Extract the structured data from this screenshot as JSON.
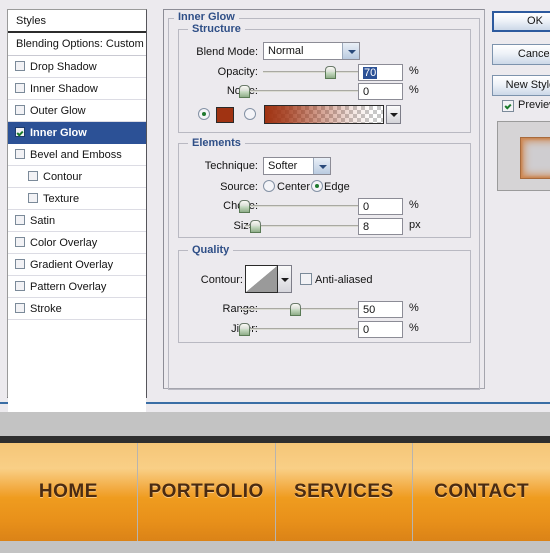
{
  "dialog": {
    "styles_panel": {
      "header": "Styles",
      "blending_options": "Blending Options: Custom",
      "items": [
        {
          "label": "Drop Shadow",
          "checked": false,
          "indent": false,
          "selected": false
        },
        {
          "label": "Inner Shadow",
          "checked": false,
          "indent": false,
          "selected": false
        },
        {
          "label": "Outer Glow",
          "checked": false,
          "indent": false,
          "selected": false
        },
        {
          "label": "Inner Glow",
          "checked": true,
          "indent": false,
          "selected": true
        },
        {
          "label": "Bevel and Emboss",
          "checked": false,
          "indent": false,
          "selected": false
        },
        {
          "label": "Contour",
          "checked": false,
          "indent": true,
          "selected": false
        },
        {
          "label": "Texture",
          "checked": false,
          "indent": true,
          "selected": false
        },
        {
          "label": "Satin",
          "checked": false,
          "indent": false,
          "selected": false
        },
        {
          "label": "Color Overlay",
          "checked": false,
          "indent": false,
          "selected": false
        },
        {
          "label": "Gradient Overlay",
          "checked": false,
          "indent": false,
          "selected": false
        },
        {
          "label": "Pattern Overlay",
          "checked": false,
          "indent": false,
          "selected": false
        },
        {
          "label": "Stroke",
          "checked": false,
          "indent": false,
          "selected": false
        }
      ]
    },
    "effect_title": "Inner Glow",
    "structure": {
      "legend": "Structure",
      "blend_mode_label": "Blend Mode:",
      "blend_mode_value": "Normal",
      "opacity_label": "Opacity:",
      "opacity_value": "70",
      "opacity_unit": "%",
      "noise_label": "Noise:",
      "noise_value": "0",
      "noise_unit": "%",
      "fill_color": "#A03312",
      "color_mode": "solid"
    },
    "elements": {
      "legend": "Elements",
      "technique_label": "Technique:",
      "technique_value": "Softer",
      "source_label": "Source:",
      "source_center": "Center",
      "source_edge": "Edge",
      "source_value": "Edge",
      "choke_label": "Choke:",
      "choke_value": "0",
      "choke_unit": "%",
      "size_label": "Size:",
      "size_value": "8",
      "size_unit": "px"
    },
    "quality": {
      "legend": "Quality",
      "contour_label": "Contour:",
      "anti_aliased_label": "Anti-aliased",
      "anti_aliased_checked": false,
      "range_label": "Range:",
      "range_value": "50",
      "range_unit": "%",
      "jitter_label": "Jitter:",
      "jitter_value": "0",
      "jitter_unit": "%"
    },
    "buttons": {
      "ok": "OK",
      "cancel": "Cancel",
      "new_style": "New Style...",
      "preview_label": "Preview",
      "preview_checked": true
    }
  },
  "navbar": {
    "items": [
      {
        "label": "HOME"
      },
      {
        "label": "PORTFOLIO"
      },
      {
        "label": "SERVICES"
      },
      {
        "label": "CONTACT"
      }
    ],
    "accent_color": "#EF9C1F",
    "text_color": "#4A2B12"
  }
}
